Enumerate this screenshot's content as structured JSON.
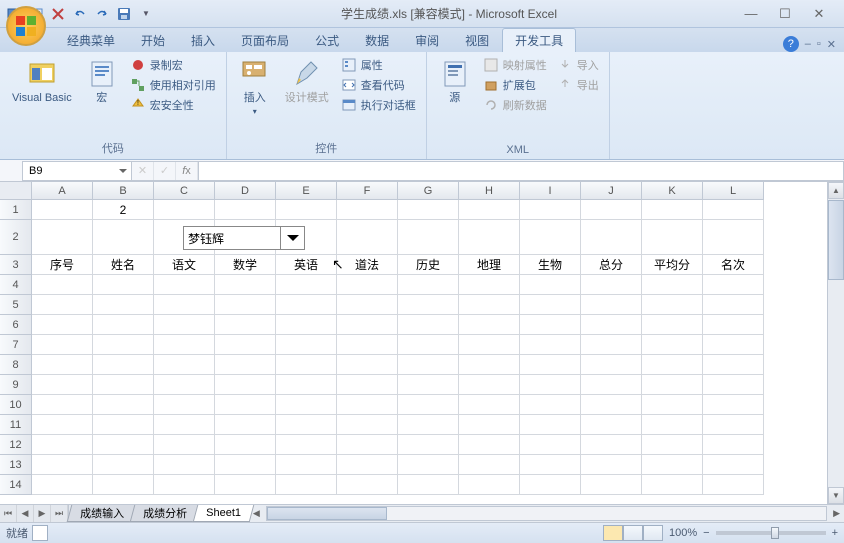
{
  "title": "学生成绩.xls  [兼容模式] - Microsoft Excel",
  "tabs": [
    "经典菜单",
    "开始",
    "插入",
    "页面布局",
    "公式",
    "数据",
    "审阅",
    "视图",
    "开发工具"
  ],
  "active_tab": 8,
  "ribbon": {
    "groups": [
      {
        "title": "代码",
        "big": [
          {
            "label": "Visual Basic"
          },
          {
            "label": "宏"
          }
        ],
        "small": [
          {
            "label": "录制宏"
          },
          {
            "label": "使用相对引用"
          },
          {
            "label": "宏安全性"
          }
        ]
      },
      {
        "title": "控件",
        "big": [
          {
            "label": "插入"
          },
          {
            "label": "设计模式"
          }
        ],
        "small": [
          {
            "label": "属性"
          },
          {
            "label": "查看代码"
          },
          {
            "label": "执行对话框"
          }
        ]
      },
      {
        "title": "XML",
        "big": [
          {
            "label": "源"
          }
        ],
        "small_cols": [
          [
            {
              "label": "映射属性",
              "disabled": true
            },
            {
              "label": "扩展包"
            },
            {
              "label": "刷新数据",
              "disabled": true
            }
          ],
          [
            {
              "label": "导入",
              "disabled": true
            },
            {
              "label": "导出",
              "disabled": true
            }
          ]
        ]
      }
    ]
  },
  "name_box": "B9",
  "columns": [
    "A",
    "B",
    "C",
    "D",
    "E",
    "F",
    "G",
    "H",
    "I",
    "J",
    "K",
    "L"
  ],
  "rows": [
    1,
    2,
    3,
    4,
    5,
    6,
    7,
    8,
    9,
    10,
    11,
    12,
    13,
    14
  ],
  "cell_data": {
    "B1": "2",
    "row3": [
      "序号",
      "姓名",
      "语文",
      "数学",
      "英语",
      "道法",
      "历史",
      "地理",
      "生物",
      "总分",
      "平均分",
      "名次"
    ]
  },
  "combo_value": "梦钰辉",
  "sheets": [
    "成绩输入",
    "成绩分析",
    "Sheet1"
  ],
  "active_sheet": 2,
  "status": {
    "ready": "就绪",
    "zoom": "100%"
  }
}
